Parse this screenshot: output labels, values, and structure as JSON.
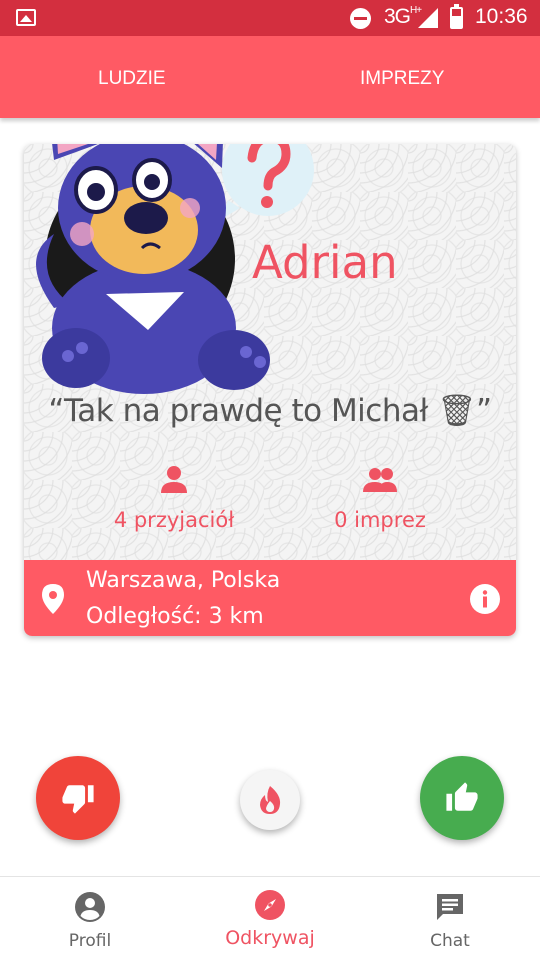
{
  "status_bar": {
    "network": "3G",
    "network_badge": "H+",
    "time": "10:36"
  },
  "tabs": [
    {
      "label": "LUDZIE"
    },
    {
      "label": "IMPREZY"
    }
  ],
  "profile_card": {
    "name": "Adrian",
    "quote": "“Tak na prawdę to Michał 🗑”",
    "friends_label": "4 przyjaciół",
    "parties_label": "0 imprez",
    "location": "Warszawa, Polska",
    "distance": "Odległość: 3 km"
  },
  "bottom_nav": [
    {
      "label": "Profil",
      "icon": "account-circle-icon"
    },
    {
      "label": "Odkrywaj",
      "icon": "compass-icon"
    },
    {
      "label": "Chat",
      "icon": "chat-icon"
    }
  ],
  "colors": {
    "accent": "#ff5a64",
    "status_bar": "#d32f3f",
    "dislike": "#f0443a",
    "like": "#47ac4f"
  }
}
